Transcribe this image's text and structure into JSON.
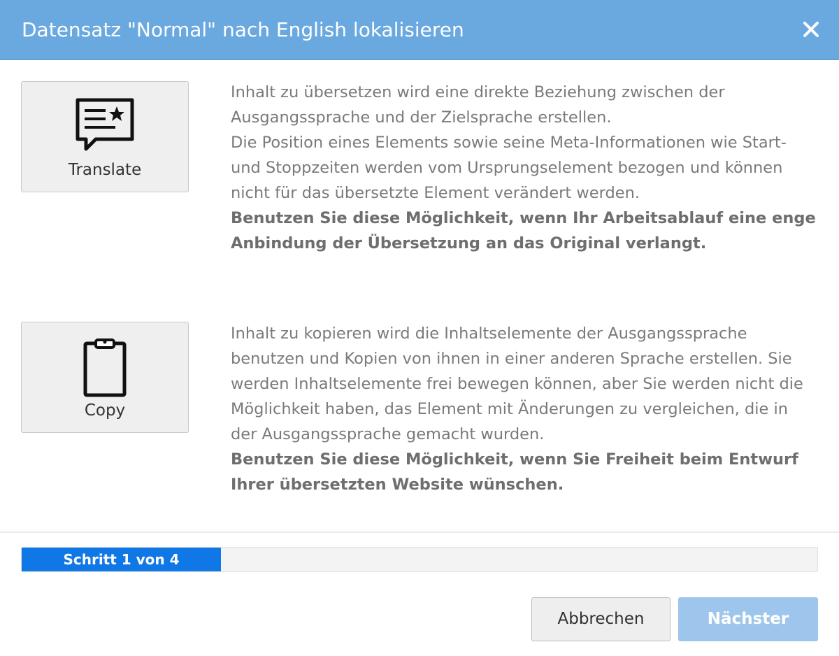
{
  "dialog": {
    "title": "Datensatz \"Normal\" nach English lokalisieren",
    "close_icon": "close-icon"
  },
  "options": {
    "translate": {
      "label": "Translate",
      "icon": "translate-speech-bubble-icon",
      "description": [
        "Inhalt zu übersetzen wird eine direkte Beziehung zwischen der Ausgangssprache und der Zielsprache erstellen.",
        "Die Position eines Elements sowie seine Meta-Informationen wie Start- und Stoppzeiten werden vom Ursprungselement bezogen und können nicht für das übersetzte Element verändert werden."
      ],
      "emphasis": "Benutzen Sie diese Möglichkeit, wenn Ihr Arbeitsablauf eine enge Anbindung der Übersetzung an das Original verlangt."
    },
    "copy": {
      "label": "Copy",
      "icon": "clipboard-icon",
      "description": [
        "Inhalt zu kopieren wird die Inhaltselemente der Ausgangssprache benutzen und Kopien von ihnen in einer anderen Sprache erstellen. Sie werden Inhaltselemente frei bewegen können, aber Sie werden nicht die Möglichkeit haben, das Element mit Änderungen zu vergleichen, die in der Ausgangssprache gemacht wurden."
      ],
      "emphasis": "Benutzen Sie diese Möglichkeit, wenn Sie Freiheit beim Entwurf Ihrer übersetzten Website wünschen."
    }
  },
  "progress": {
    "label": "Schritt 1 von 4",
    "current_step": 1,
    "total_steps": 4,
    "fraction": 0.25,
    "fill_color": "#0f78e6"
  },
  "buttons": {
    "cancel": "Abbrechen",
    "next": "Nächster"
  },
  "colors": {
    "header": "#6aa9e0",
    "next_button_disabled": "#9ec6ec"
  }
}
